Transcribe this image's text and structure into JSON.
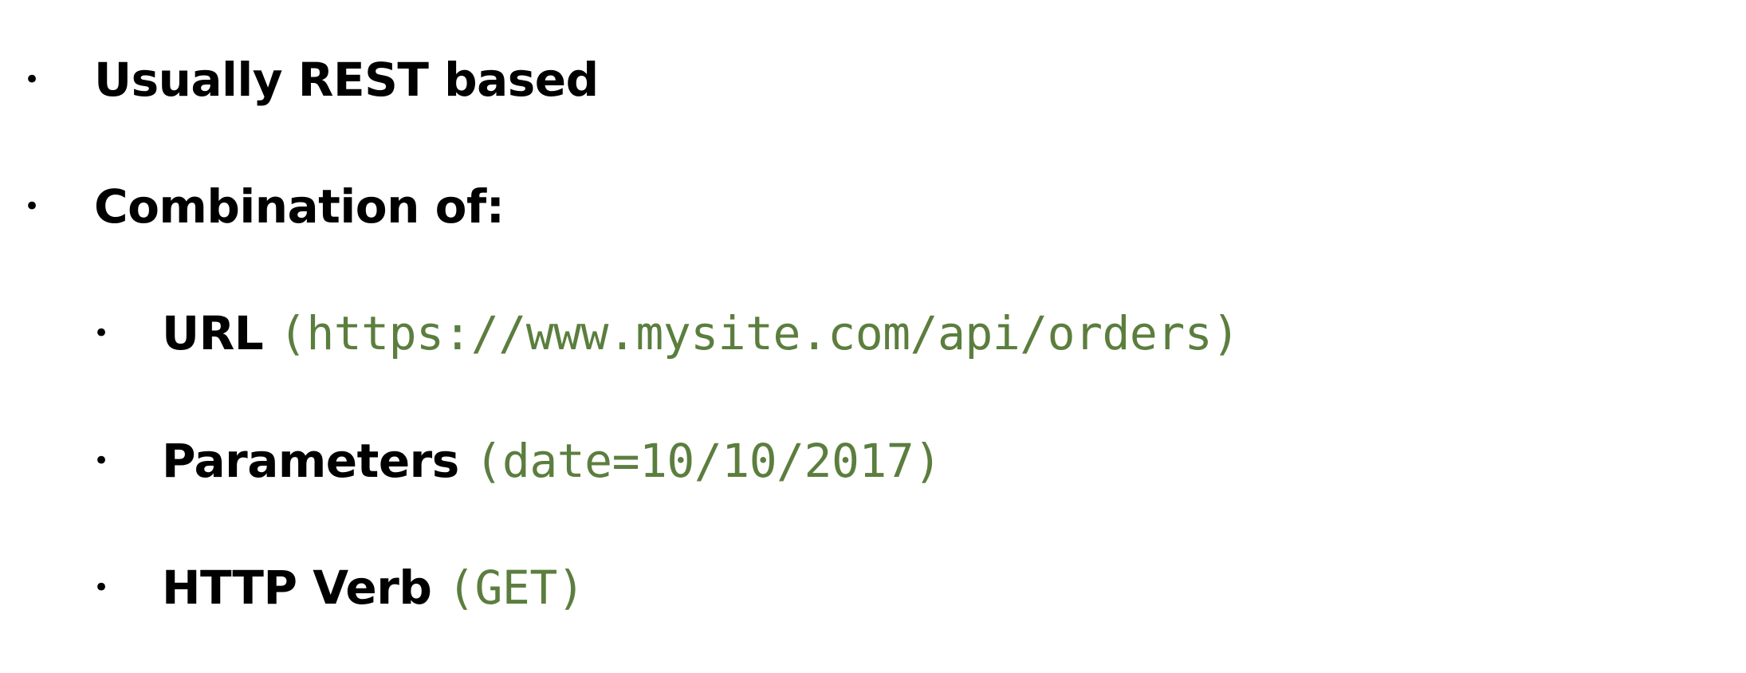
{
  "colors": {
    "text": "#000000",
    "code": "#5b7e3e",
    "background": "#ffffff"
  },
  "bullet_glyph": "•",
  "items": [
    {
      "level": 1,
      "text": "Usually REST based",
      "code": ""
    },
    {
      "level": 1,
      "text": "Combination of:",
      "code": ""
    },
    {
      "level": 2,
      "text": "URL",
      "code": "(https://www.mysite.com/api/orders)"
    },
    {
      "level": 2,
      "text": "Parameters",
      "code": "(date=10/10/2017)"
    },
    {
      "level": 2,
      "text": "HTTP Verb",
      "code": "(GET)"
    }
  ]
}
